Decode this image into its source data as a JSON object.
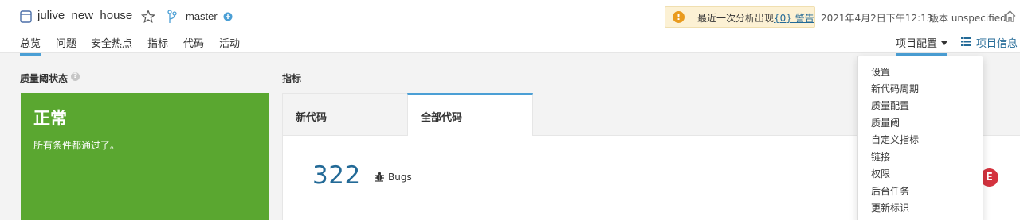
{
  "header": {
    "project_icon": "project-icon",
    "project_name": "julive_new_house",
    "star_icon": "star-icon",
    "branch_icon": "branch-icon",
    "branch_name": "master",
    "branch_add_icon": "plus-circle-icon",
    "warning": {
      "icon": "exclamation-icon",
      "text": "最近一次分析出现",
      "link_text": "{0} 警告"
    },
    "analysis_date": "2021年4月2日下午12:13",
    "version": "版本 unspecified",
    "home_icon": "home-icon"
  },
  "nav": {
    "items": [
      {
        "label": "总览",
        "active": true
      },
      {
        "label": "问题",
        "active": false
      },
      {
        "label": "安全热点",
        "active": false
      },
      {
        "label": "指标",
        "active": false
      },
      {
        "label": "代码",
        "active": false
      },
      {
        "label": "活动",
        "active": false
      }
    ],
    "project_config": "项目配置",
    "project_info": "项目信息"
  },
  "quality_gate": {
    "title": "质量阈状态",
    "status": "正常",
    "description": "所有条件都通过了。",
    "color": "#5aa730"
  },
  "metrics": {
    "title": "指标",
    "tabs": [
      {
        "label": "新代码",
        "active": false
      },
      {
        "label": "全部代码",
        "active": true
      }
    ],
    "bugs_value": "322",
    "bugs_label": "Bugs",
    "rating": "E",
    "rating_color": "#d4333f"
  },
  "dropdown": {
    "items": [
      "设置",
      "新代码周期",
      "质量配置",
      "质量阈",
      "自定义指标",
      "链接",
      "权限",
      "后台任务",
      "更新标识"
    ]
  },
  "colors": {
    "accent": "#4b9fd5",
    "link": "#236a97",
    "warning_bg": "#fcf1d4"
  }
}
